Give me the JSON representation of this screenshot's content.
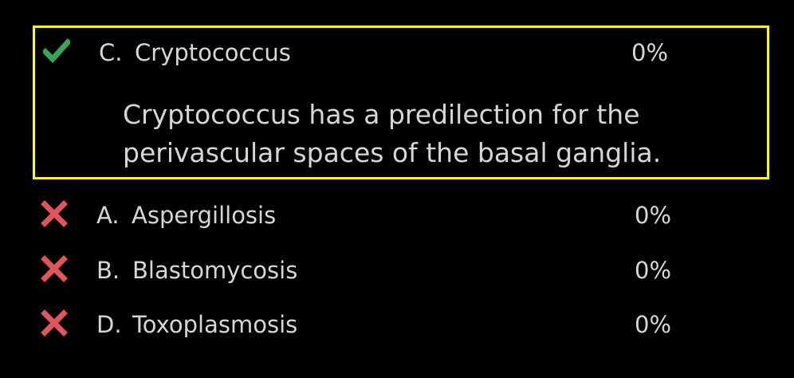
{
  "colors": {
    "background": "#000000",
    "text": "#d6d6d6",
    "highlight_border": "#ffff00",
    "correct_icon": "#3aa655",
    "wrong_icon": "#e0555a"
  },
  "correct_answer": {
    "icon": "checkmark-icon",
    "letter": "C.",
    "label": "Cryptococcus",
    "percent": "0%",
    "explanation": "Cryptococcus has a predilection for the perivascular spaces of the basal ganglia."
  },
  "other_answers": [
    {
      "icon": "x-icon",
      "letter": "A.",
      "label": "Aspergillosis",
      "percent": "0%"
    },
    {
      "icon": "x-icon",
      "letter": "B.",
      "label": "Blastomycosis",
      "percent": "0%"
    },
    {
      "icon": "x-icon",
      "letter": "D.",
      "label": "Toxoplasmosis",
      "percent": "0%"
    }
  ]
}
